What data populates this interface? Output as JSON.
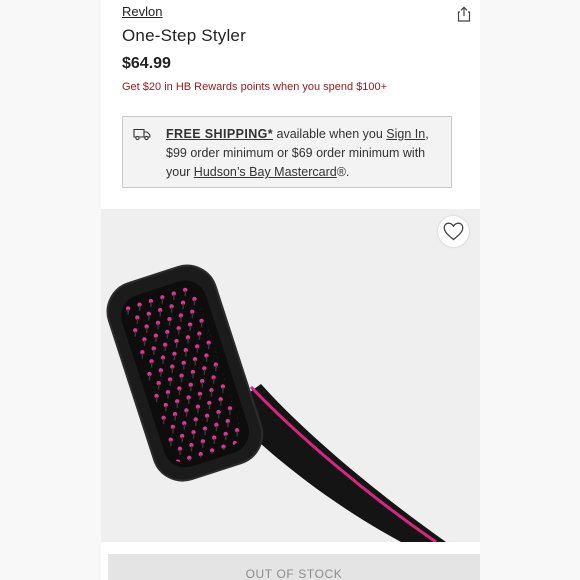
{
  "product": {
    "brand": "Revlon",
    "title": "One-Step Styler",
    "price": "$64.99",
    "rewards_text": "Get $20 in HB Rewards points when you spend $100+"
  },
  "shipping": {
    "free_shipping_label": "FREE SHIPPING*",
    "text_1": " available when you ",
    "sign_in_label": "Sign In",
    "text_2": ", $99 order minimum or $69 order minimum with your ",
    "card_label": "Hudson’s Bay Mastercard",
    "text_3": "®."
  },
  "actions": {
    "out_of_stock_label": "OUT OF STOCK"
  },
  "icons": {
    "share": "share-icon",
    "truck": "truck-icon",
    "wishlist": "heart-icon"
  },
  "colors": {
    "rewards_text": "#9b1b22",
    "product_pink": "#e2338d",
    "image_background": "#efefef"
  }
}
